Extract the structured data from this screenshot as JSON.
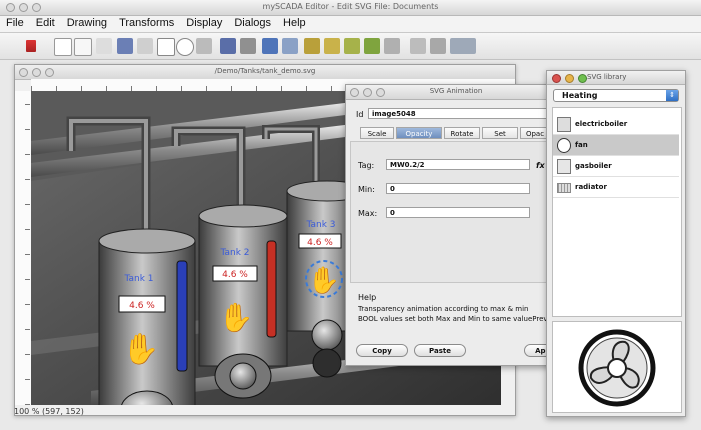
{
  "app": {
    "title": "mySCADA Editor - Edit SVG File: Documents",
    "menu": [
      "File",
      "Edit",
      "Drawing",
      "Transforms",
      "Display",
      "Dialogs",
      "Help"
    ]
  },
  "document": {
    "title": "/Demo/Tanks/tank_demo.svg",
    "status": "100 % (597, 152)"
  },
  "tanks": [
    {
      "label": "Tank 1",
      "value": "4.6 %",
      "level_color": "#2a3fb8"
    },
    {
      "label": "Tank 2",
      "value": "4.6 %",
      "level_color": "#c63024"
    },
    {
      "label": "Tank 3",
      "value": "4.6 %",
      "level_color": "#3eaa2b"
    }
  ],
  "dialog": {
    "title": "SVG Animation",
    "id_label": "Id",
    "id_value": "image5048",
    "tabs": [
      "Scale",
      "Opacity",
      "Rotate",
      "Set",
      "Opac"
    ],
    "tag_label": "Tag:",
    "tag_value": "MW0.2/2",
    "tag_suffix": "fx",
    "min_label": "Min:",
    "min_value": "0",
    "max_label": "Max:",
    "max_value": "0",
    "help_title": "Help",
    "help_line1": "Transparency animation according to max & min",
    "help_line2": "BOOL values set both Max and Min to same valuePreview:",
    "buttons": {
      "copy": "Copy",
      "paste": "Paste",
      "apply": "Appl"
    }
  },
  "library": {
    "title": "SVG library",
    "category": "Heating",
    "items": [
      {
        "label": "electricboiler",
        "selected": false
      },
      {
        "label": "fan",
        "selected": true
      },
      {
        "label": "gasboiler",
        "selected": false
      },
      {
        "label": "radiator",
        "selected": false
      }
    ]
  }
}
